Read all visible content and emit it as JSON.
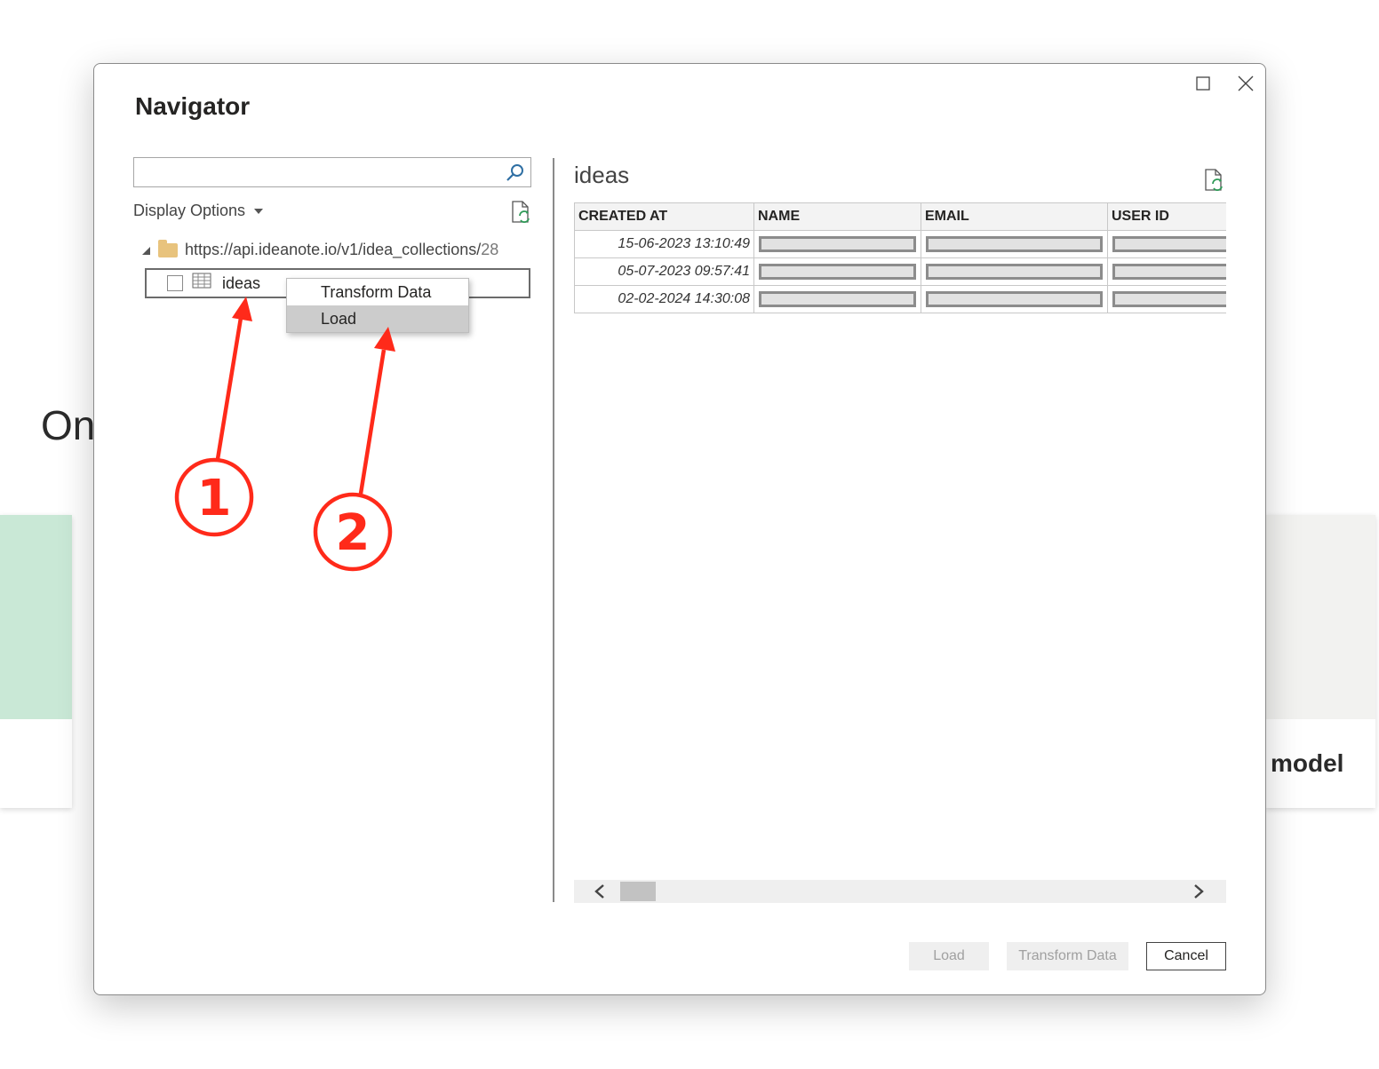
{
  "background": {
    "heading_fragment": "On",
    "card_right_text": "model"
  },
  "dialog": {
    "title": "Navigator",
    "maximize_icon": "maximize-icon",
    "close_icon": "close-icon"
  },
  "left_pane": {
    "search": {
      "value": "",
      "placeholder": ""
    },
    "display_options_label": "Display Options",
    "tree": {
      "root": {
        "url": "https://api.ideanote.io/v1/idea_collections/",
        "suffix": "28"
      },
      "items": [
        {
          "label": "ideas",
          "checked": false
        }
      ]
    },
    "context_menu": {
      "items": [
        {
          "label": "Transform Data"
        },
        {
          "label": "Load",
          "highlighted": true
        }
      ]
    }
  },
  "preview": {
    "title": "ideas",
    "columns": [
      "CREATED AT",
      "NAME",
      "EMAIL",
      "USER ID"
    ],
    "rows": [
      {
        "created_at": "15-06-2023 13:10:49"
      },
      {
        "created_at": "05-07-2023 09:57:41"
      },
      {
        "created_at": "02-02-2024 14:30:08"
      }
    ]
  },
  "footer": {
    "load_label": "Load",
    "transform_label": "Transform Data",
    "cancel_label": "Cancel"
  },
  "annotations": {
    "badge1": "1",
    "badge2": "2",
    "color": "#ff2a1a"
  }
}
